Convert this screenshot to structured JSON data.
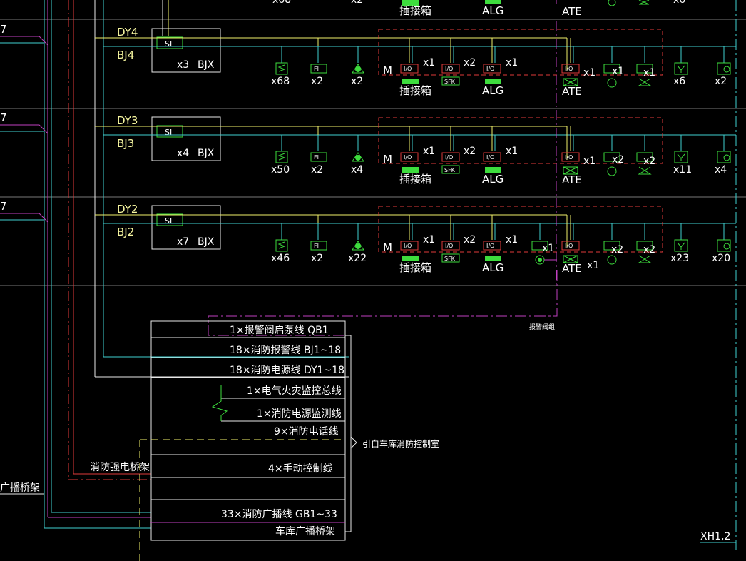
{
  "colors": {
    "background": "#000000",
    "cyan": "#3fd0d0",
    "yellow": "#f0f06a",
    "magenta": "#c040c0",
    "red": "#e03a3a",
    "green": "#3ddc3d",
    "white": "#e8e8e8",
    "grey": "#777777",
    "blue": "#4a6cff"
  },
  "rows": [
    {
      "dy": "DY4",
      "bj": "BJ4",
      "si": "SI",
      "si_count": "x3",
      "bjx": "BJX",
      "counts": [
        "x68",
        "x2",
        "x2",
        "x1",
        "x2",
        "x1",
        "x1",
        "x1",
        "x1",
        "x6",
        "x2"
      ],
      "m": "M",
      "cha": "插接箱",
      "alg": "ALG",
      "ate": "ATE",
      "sfk": "SFK",
      "io": "I/O",
      "fi": "FI",
      "has_alarm_valve": false
    },
    {
      "dy": "DY3",
      "bj": "BJ3",
      "si": "SI",
      "si_count": "x4",
      "bjx": "BJX",
      "counts": [
        "x50",
        "x2",
        "x4",
        "x1",
        "x2",
        "x1",
        "x1",
        "x2",
        "x2",
        "x11",
        "x4"
      ],
      "m": "M",
      "cha": "插接箱",
      "alg": "ALG",
      "ate": "ATE",
      "sfk": "SFK",
      "io": "I/O",
      "fi": "FI",
      "has_alarm_valve": false
    },
    {
      "dy": "DY2",
      "bj": "BJ2",
      "si": "SI",
      "si_count": "x7",
      "bjx": "BJX",
      "counts": [
        "x46",
        "x2",
        "x22",
        "x1",
        "x2",
        "x1",
        "x1",
        "x1",
        "x2",
        "x2",
        "x23",
        "x20"
      ],
      "m": "M",
      "cha": "插接箱",
      "alg": "ALG",
      "ate": "ATE",
      "sfk": "SFK",
      "io": "I/O",
      "fi": "FI",
      "has_alarm_valve": true
    }
  ],
  "top_partial": {
    "counts_left": [
      "x68",
      "x2"
    ],
    "cha": "插接箱",
    "alg": "ALG",
    "ate": "ATE",
    "right": "x6"
  },
  "left_markers": [
    "7",
    "7",
    "7"
  ],
  "alarm_valve_label": "报警阀组",
  "cable_box": {
    "lines": [
      "1×报警阀启泵线 QB1",
      "18×消防报警线 BJ1~18",
      "18×消防电源线 DY1~18",
      "1×电气火灾监控总线",
      "1×消防电源监测线",
      "9×消防电话线",
      "4×手动控制线",
      "33×消防广播线 GB1~33",
      "车库广播桥架"
    ],
    "route_label": "引自车库消防控制室",
    "power_tray_label": "消防强电桥架",
    "broadcast_tray_label": "广播桥架",
    "xh_label": "XH1,2"
  }
}
